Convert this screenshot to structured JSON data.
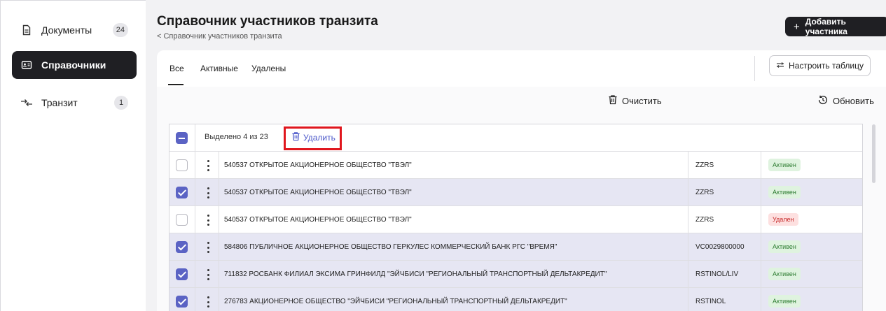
{
  "sidebar": {
    "items": [
      {
        "label": "Документы",
        "badge": "24",
        "icon": "document-icon"
      },
      {
        "label": "Справочники",
        "icon": "id-card-icon"
      },
      {
        "label": "Транзит",
        "badge": "1",
        "icon": "transit-arrows-icon"
      }
    ]
  },
  "header": {
    "title": "Справочник участников транзита",
    "breadcrumb": "< Справочник участников транзита",
    "add_button": "Добавить участника",
    "add_symbol": "+"
  },
  "tabs": [
    {
      "label": "Все",
      "active": true
    },
    {
      "label": "Активные"
    },
    {
      "label": "Удалены"
    }
  ],
  "toolbar": {
    "configure_table": "Настроить таблицу",
    "clear": "Очистить",
    "refresh": "Обновить"
  },
  "table": {
    "selection_text": "Выделено 4 из 23",
    "delete_label": "Удалить",
    "rows": [
      {
        "name": "540537 ОТКРЫТОЕ АКЦИОНЕРНОЕ ОБЩЕСТВО \"ТВЭЛ\"",
        "code": "ZZRS",
        "status": "Активен",
        "checked": false
      },
      {
        "name": "540537 ОТКРЫТОЕ АКЦИОНЕРНОЕ ОБЩЕСТВО \"ТВЭЛ\"",
        "code": "ZZRS",
        "status": "Активен",
        "checked": true
      },
      {
        "name": "540537 ОТКРЫТОЕ АКЦИОНЕРНОЕ ОБЩЕСТВО \"ТВЭЛ\"",
        "code": "ZZRS",
        "status": "Удален",
        "checked": false
      },
      {
        "name": "584806 ПУБЛИЧНОЕ АКЦИОНЕРНОЕ ОБЩЕСТВО ГЕРКУЛЕС КОММЕРЧЕСКИЙ БАНК РГС \"ВРЕМЯ\"",
        "code": "VC0029800000",
        "status": "Активен",
        "checked": true
      },
      {
        "name": "711832 РОСБАНК ФИЛИАЛ ЭКСИМА ГРИНФИЛД \"ЭЙЧБИСИ \"РЕГИОНАЛЬНЫЙ ТРАНСПОРТНЫЙ ДЕЛЬТАКРЕДИТ\"",
        "code": "RSTINOL/LIV",
        "status": "Активен",
        "checked": true
      },
      {
        "name": "276783 АКЦИОНЕРНОЕ ОБЩЕСТВО \"ЭЙЧБИСИ \"РЕГИОНАЛЬНЫЙ ТРАНСПОРТНЫЙ ДЕЛЬТАКРЕДИТ\"",
        "code": "RSTINOL",
        "status": "Активен",
        "checked": true
      }
    ]
  },
  "colors": {
    "accent": "#5b63c4",
    "dark_button": "#1f1f23",
    "highlight": "#e0161d",
    "active_status": "#2e7d32",
    "deleted_status": "#c62828"
  }
}
